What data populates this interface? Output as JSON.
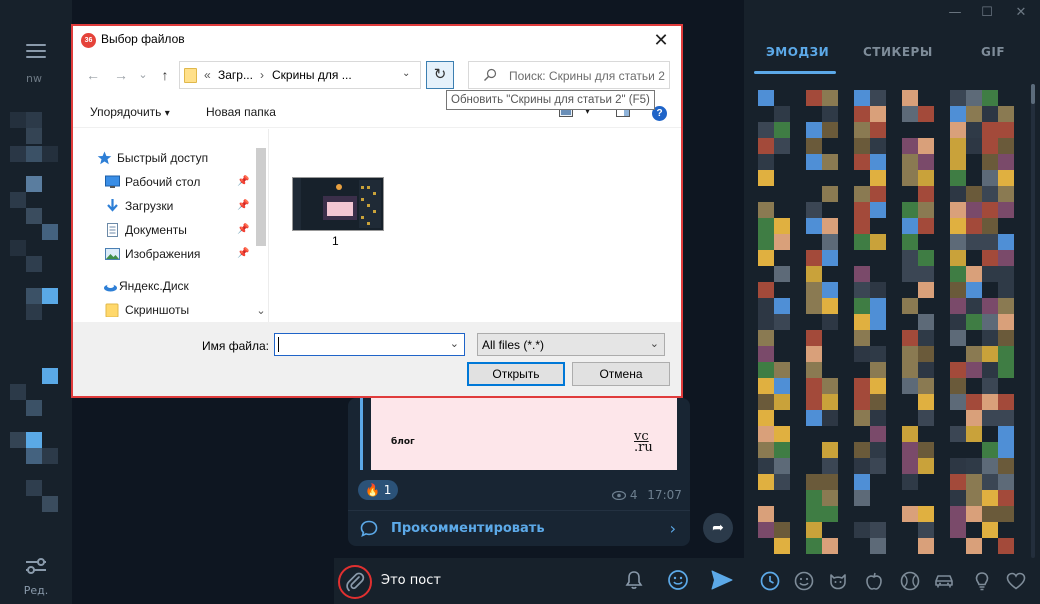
{
  "window_controls": {
    "minimize": "—",
    "maximize": "☐",
    "close": "✕"
  },
  "left_rail": {
    "partial_label": "nw",
    "settings_label": "Ред."
  },
  "chat": {
    "post": {
      "preview_text": "блог",
      "vc_logo_top": "vc",
      "vc_logo_bottom": ".ru",
      "reaction_emoji": "🔥",
      "reaction_count": "1",
      "views": "4",
      "time": "17:07",
      "comment_label": "Прокомментировать",
      "comment_arrow": "›",
      "share_glyph": "➦"
    },
    "input": {
      "text": "Это пост"
    }
  },
  "emoji_panel": {
    "tabs": [
      {
        "label": "ЭМОДЗИ",
        "active": true
      },
      {
        "label": "СТИКЕРЫ",
        "active": false
      },
      {
        "label": "GIF",
        "active": false
      }
    ],
    "categories": [
      "clock-icon",
      "smile-icon",
      "cat-icon",
      "apple-icon",
      "ball-icon",
      "car-icon",
      "bulb-icon",
      "heart-icon"
    ]
  },
  "dialog": {
    "title": "Выбор файлов",
    "app_badge": "36",
    "close": "✕",
    "nav": {
      "back": "←",
      "forward": "→",
      "dropdown": "⌄",
      "up": "↑"
    },
    "address": {
      "chevrons": "«",
      "segments": [
        "Загр...",
        "Скрины для ..."
      ],
      "separator": "›",
      "dropdown": "⌄"
    },
    "refresh_glyph": "↻",
    "search_placeholder": "Поиск: Скрины для статьи 2",
    "tooltip": "Обновить \"Скрины для статьи 2\" (F5)",
    "toolbar": {
      "organize": "Упорядочить",
      "organize_arrow": "▾",
      "new_folder": "Новая папка",
      "help": "?",
      "view_arrow": "▾"
    },
    "nav_pane": [
      {
        "label": "Быстрый доступ",
        "icon": "star-icon",
        "pinned": false
      },
      {
        "label": "Рабочий стол",
        "icon": "desktop-icon",
        "pinned": true
      },
      {
        "label": "Загрузки",
        "icon": "download-icon",
        "pinned": true
      },
      {
        "label": "Документы",
        "icon": "documents-icon",
        "pinned": true
      },
      {
        "label": "Изображения",
        "icon": "pictures-icon",
        "pinned": true
      },
      {
        "label": "Яндекс.Диск",
        "icon": "yandex-disk-icon",
        "pinned": false
      },
      {
        "label": "Скриншоты",
        "icon": "folder-icon",
        "pinned": false
      }
    ],
    "pin_glyph": "📌",
    "scroll_down": "⌄",
    "files": [
      {
        "name": "1"
      }
    ],
    "filename_label": "Имя файла:",
    "filename_value": "",
    "filter": "All files (*.*)",
    "open_button": "Открыть",
    "cancel_button": "Отмена"
  }
}
